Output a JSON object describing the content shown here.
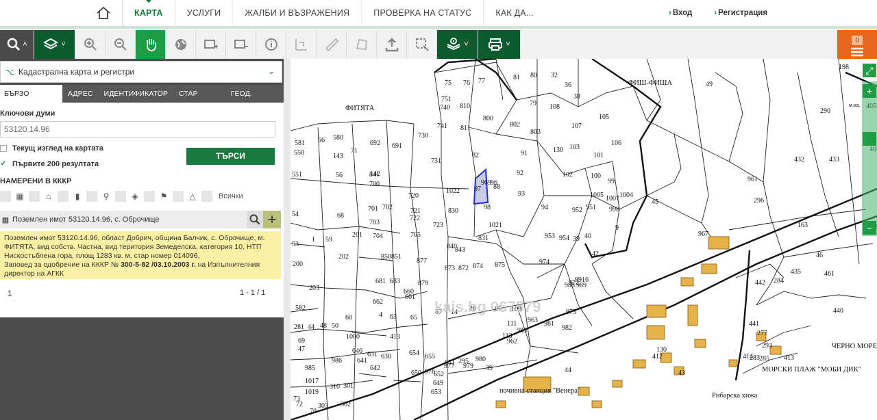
{
  "nav": {
    "items": [
      "КАРТА",
      "УСЛУГИ",
      "ЖАЛБИ И ВЪЗРАЖЕНИЯ",
      "ПРОВЕРКА НА СТАТУС",
      "КАК ДА..."
    ],
    "login": "Вход",
    "register": "Регистрация"
  },
  "toolbar": {
    "counter": "0"
  },
  "panel": {
    "title": "Кадастрална карта и регистри",
    "tabs": [
      "БЪРЗО ТЪРСЕНЕ",
      "АДРЕС",
      "ИДЕНТИФИКАТОР",
      "СТАР ИДЕНТ.",
      "ГЕОД. ОСНОВА"
    ],
    "keywords_label": "Ключови думи",
    "keywords_value": "53120.14.96",
    "opt_current_view": "Текущ изглед на картата",
    "opt_first_200": "Първите 200 резултата",
    "search_button": "ТЪРСИ",
    "found_label": "НАМЕРЕНИ В КККР",
    "all_label": "Всички",
    "result_title": "Поземлен имот 53120.14.96, с. Оброчище",
    "result_text_1": "Поземлен имот 53120.14.96, област Добрич, община Балчик, с. Оброчище, м. ФИТЯТА, вид собств. Частна, вид територия Земеделска, категория 10, НТП Нискостъблена гора, площ 1283 кв. м, стар номер 014096,",
    "result_text_2a": "Заповед за одобрение на КККР № ",
    "result_text_2b": "300-5-82 /03.10.2003 г.",
    "result_text_2c": " на Изпълнителния директор на АГКК",
    "page_num": "1",
    "page_range": "1 - 1 / 1"
  },
  "map": {
    "areas": [
      "ФИТЯТА",
      "ФИШ-ФИША",
      "ЧЕРНО МОРЕ",
      "МОРСКИ ПЛАЖ \"МОБИ ДИК\"",
      "почивна станция \"Венера\"",
      "Рибарска хижа",
      "м.кв."
    ],
    "watermark": "kais.bg 067579",
    "parcels": [
      "75",
      "76",
      "77",
      "751",
      "740",
      "810",
      "741",
      "811",
      "800",
      "730",
      "731",
      "82",
      "81",
      "80",
      "32",
      "36",
      "38",
      "79",
      "108",
      "105",
      "107",
      "106",
      "802",
      "803",
      "130",
      "103",
      "101",
      "91",
      "92",
      "102",
      "100",
      "99",
      "1005",
      "1007",
      "1004",
      "93",
      "94",
      "952",
      "951",
      "998",
      "9",
      "953",
      "954",
      "39",
      "40",
      "42",
      "969",
      "97",
      "96",
      "98",
      "1021",
      "1022",
      "830",
      "831",
      "88",
      "720",
      "721",
      "722",
      "723",
      "841",
      "700",
      "701",
      "702",
      "703",
      "704",
      "705",
      "840",
      "843",
      "873",
      "872",
      "874",
      "875",
      "877",
      "879",
      "850",
      "851",
      "692",
      "691",
      "142",
      "71",
      "143",
      "56",
      "68",
      "66",
      "580",
      "581",
      "550",
      "551",
      "54",
      "53",
      "1",
      "59",
      "200",
      "201",
      "202",
      "203",
      "582",
      "60",
      "1000",
      "413",
      "4",
      "63",
      "65",
      "660",
      "661",
      "662",
      "681",
      "683",
      "67",
      "14",
      "26",
      "87",
      "109",
      "111",
      "113",
      "963",
      "962",
      "983",
      "981",
      "982",
      "973",
      "972",
      "9916",
      "974",
      "988",
      "989",
      "967",
      "961",
      "296",
      "432",
      "290",
      "433",
      "405",
      "404",
      "434",
      "163",
      "168",
      "46",
      "435",
      "461",
      "284",
      "440",
      "442",
      "441",
      "277",
      "283",
      "293",
      "285",
      "414",
      "413",
      "412",
      "130",
      "43",
      "44",
      "39",
      "980",
      "295",
      "979",
      "977",
      "976",
      "652",
      "651",
      "650",
      "649",
      "653",
      "654",
      "655",
      "646",
      "641",
      "642",
      "631",
      "630",
      "985",
      "986",
      "1017",
      "1019",
      "310",
      "301",
      "302",
      "303",
      "70",
      "72",
      "73",
      "49",
      "198",
      "281",
      "44",
      "48",
      "50",
      "69",
      "47",
      "45"
    ]
  }
}
